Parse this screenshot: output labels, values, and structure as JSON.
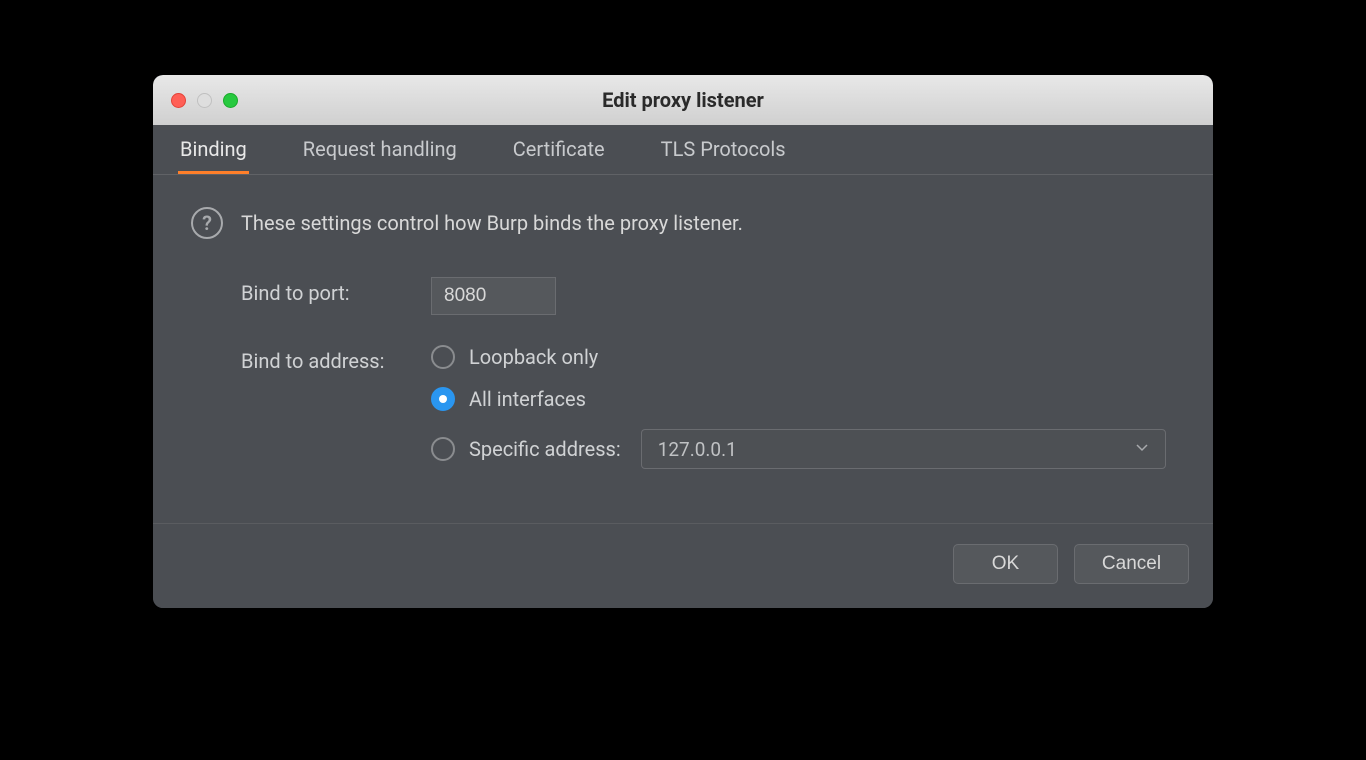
{
  "window": {
    "title": "Edit proxy listener"
  },
  "tabs": [
    {
      "label": "Binding",
      "active": true
    },
    {
      "label": "Request handling",
      "active": false
    },
    {
      "label": "Certificate",
      "active": false
    },
    {
      "label": "TLS Protocols",
      "active": false
    }
  ],
  "description": "These settings control how Burp binds the proxy listener.",
  "form": {
    "port_label": "Bind to port:",
    "port_value": "8080",
    "address_label": "Bind to address:",
    "radio_loopback": "Loopback only",
    "radio_all": "All interfaces",
    "radio_specific": "Specific address:",
    "selected_radio": "all",
    "specific_value": "127.0.0.1"
  },
  "buttons": {
    "ok": "OK",
    "cancel": "Cancel"
  },
  "icons": {
    "help": "?"
  }
}
